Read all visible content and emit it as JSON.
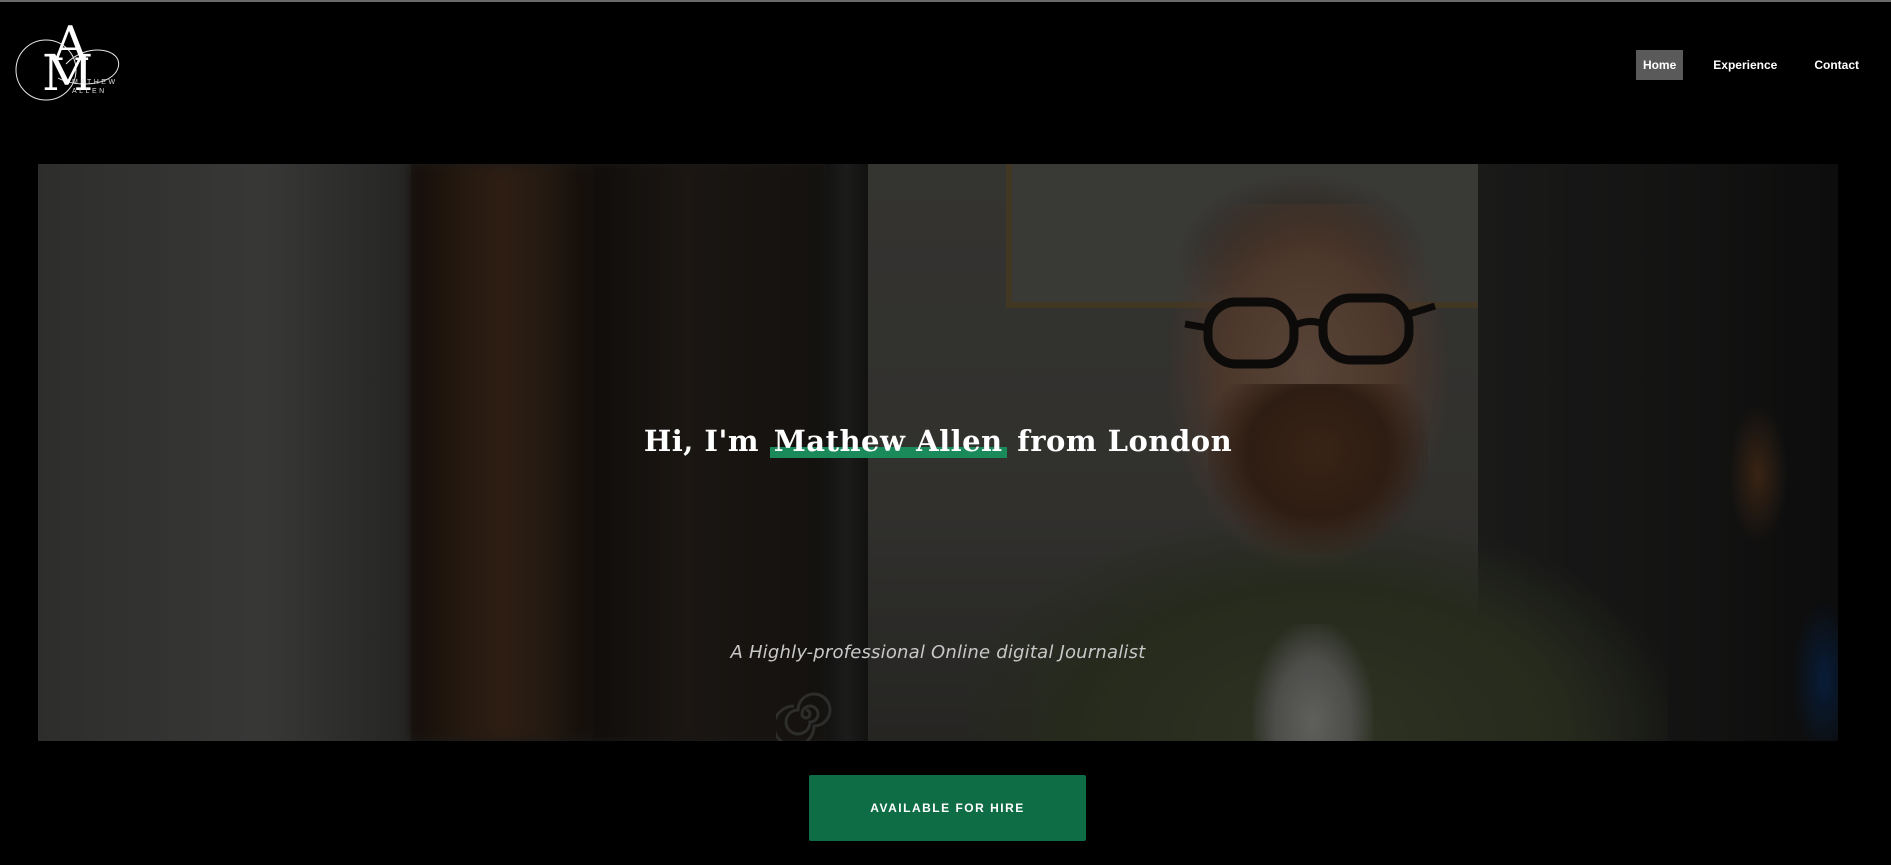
{
  "logo": {
    "monogram_primary": "A",
    "monogram_secondary": "M",
    "name_line_1": "MATHEW",
    "name_line_2": "ALLEN"
  },
  "nav": {
    "items": [
      {
        "label": "Home",
        "active": true
      },
      {
        "label": "Experience",
        "active": false
      },
      {
        "label": "Contact",
        "active": false
      }
    ]
  },
  "hero": {
    "headline_prefix": "Hi, I'm",
    "headline_name": "Mathew Allen",
    "headline_suffix": "from London",
    "tagline": "A Highly-professional Online digital Journalist"
  },
  "cta": {
    "label": "AVAILABLE FOR HIRE"
  },
  "colors": {
    "background": "#000000",
    "accent_green": "#0e6d45",
    "highlight_green": "#1a8a5a",
    "nav_active_bg": "#5a5a5a"
  }
}
